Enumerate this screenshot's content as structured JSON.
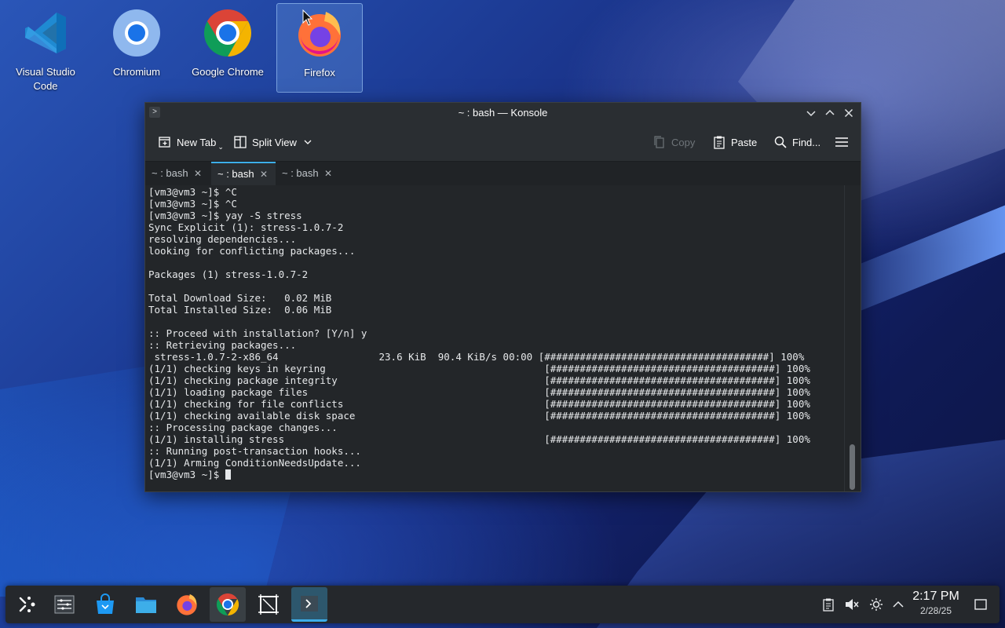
{
  "desktop": {
    "icons": [
      {
        "label": "Visual Studio\nCode",
        "icon": "vscode-icon"
      },
      {
        "label": "Chromium",
        "icon": "chromium-icon"
      },
      {
        "label": "Google Chrome",
        "icon": "chrome-icon"
      },
      {
        "label": "Firefox",
        "icon": "firefox-icon",
        "selected": true
      }
    ]
  },
  "window": {
    "title": "~ : bash — Konsole",
    "toolbar": {
      "new_tab": "New Tab",
      "split_view": "Split View",
      "copy": "Copy",
      "paste": "Paste",
      "find": "Find..."
    },
    "tabs": [
      {
        "label": "~ : bash",
        "active": false
      },
      {
        "label": "~ : bash",
        "active": true
      },
      {
        "label": "~ : bash",
        "active": false
      }
    ],
    "terminal_lines": [
      "[vm3@vm3 ~]$ ^C",
      "[vm3@vm3 ~]$ ^C",
      "[vm3@vm3 ~]$ yay -S stress",
      "Sync Explicit (1): stress-1.0.7-2",
      "resolving dependencies...",
      "looking for conflicting packages...",
      "",
      "Packages (1) stress-1.0.7-2",
      "",
      "Total Download Size:   0.02 MiB",
      "Total Installed Size:  0.06 MiB",
      "",
      ":: Proceed with installation? [Y/n] y",
      ":: Retrieving packages...",
      " stress-1.0.7-2-x86_64                 23.6 KiB  90.4 KiB/s 00:00 [######################################] 100%",
      "(1/1) checking keys in keyring                                     [######################################] 100%",
      "(1/1) checking package integrity                                   [######################################] 100%",
      "(1/1) loading package files                                        [######################################] 100%",
      "(1/1) checking for file conflicts                                  [######################################] 100%",
      "(1/1) checking available disk space                                [######################################] 100%",
      ":: Processing package changes...",
      "(1/1) installing stress                                            [######################################] 100%",
      ":: Running post-transaction hooks...",
      "(1/1) Arming ConditionNeedsUpdate..."
    ],
    "prompt": "[vm3@vm3 ~]$ "
  },
  "taskbar": {
    "apps": [
      "app-launcher-icon",
      "pager-icon",
      "discover-store-icon",
      "dolphin-files-icon",
      "firefox-icon",
      "chrome-icon",
      "screen-capture-icon",
      "konsole-icon"
    ],
    "clock": {
      "time": "2:17 PM",
      "date": "2/28/25"
    }
  }
}
